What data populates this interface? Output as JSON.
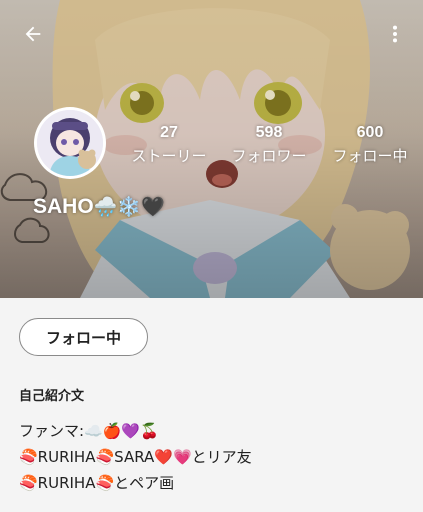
{
  "header": {
    "back_icon": "arrow-left-icon",
    "more_icon": "more-vertical-icon"
  },
  "profile": {
    "name": "SAHO",
    "name_emoji": "🌧️❄️🖤",
    "avatar_icon": "avatar-illustration"
  },
  "stats": [
    {
      "value": "27",
      "label": "ストーリー"
    },
    {
      "value": "598",
      "label": "フォロワー"
    },
    {
      "value": "600",
      "label": "フォロー中"
    }
  ],
  "follow_button": {
    "label": "フォロー中"
  },
  "bio": {
    "title": "自己紹介文",
    "lines": [
      "ファンマ:☁️🍎💜🍒",
      "🍣RURIHA🍣SARA❤️💗とリア友",
      "🍣RURIHA🍣とペア画"
    ]
  },
  "colors": {
    "background": "#f4f4f4",
    "button_border": "#8a8a8a",
    "text": "#1b1b1b",
    "overlay_text": "#ffffff"
  }
}
